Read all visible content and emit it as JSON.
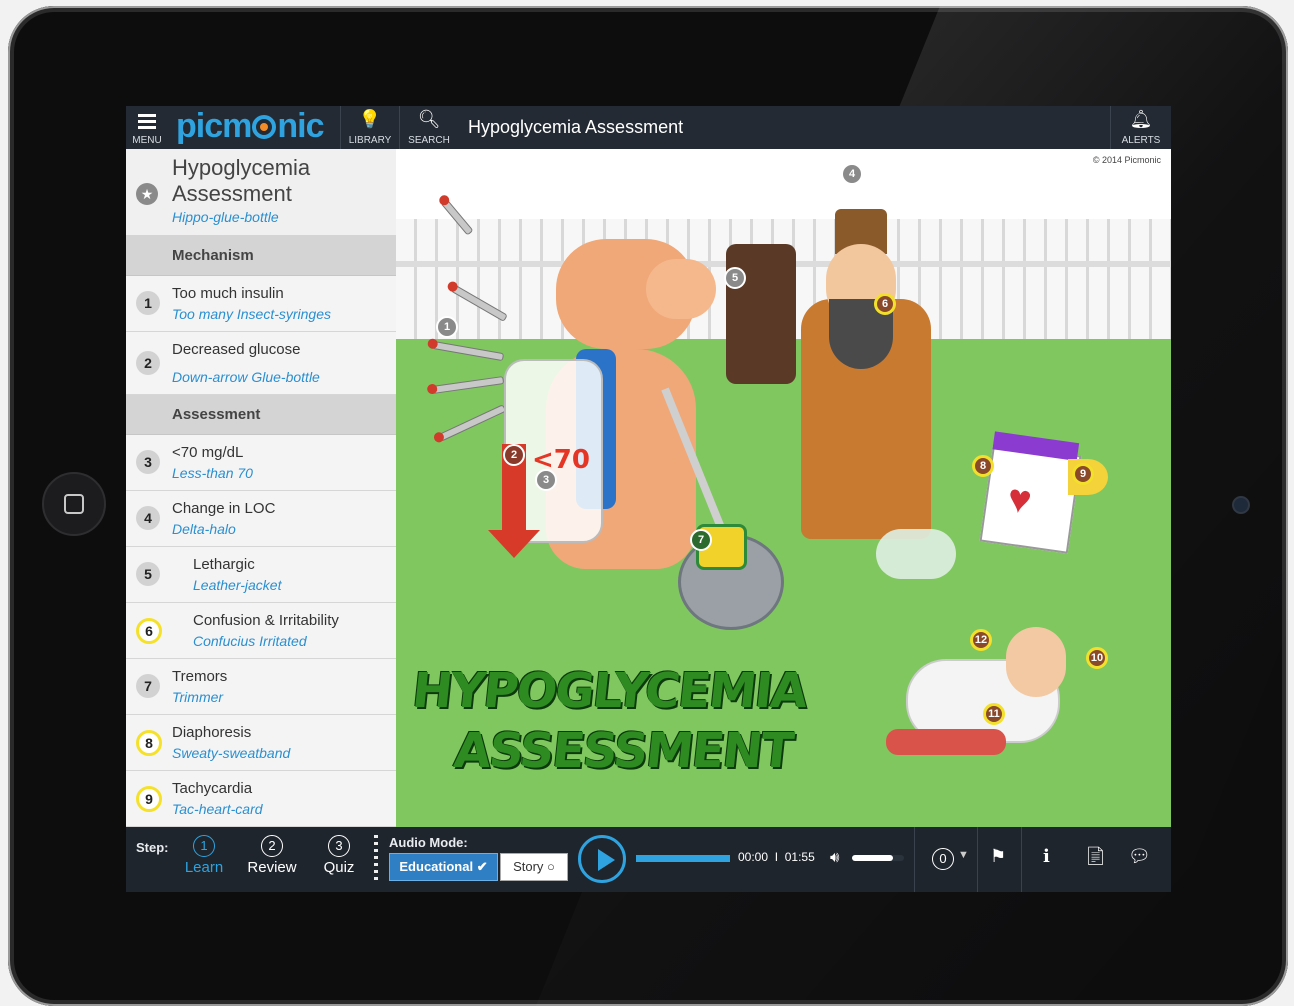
{
  "header": {
    "menu_label": "MENU",
    "logo": "picmonic",
    "library_label": "LIBRARY",
    "search_label": "SEARCH",
    "title": "Hypoglycemia  Assessment",
    "alerts_label": "ALERTS"
  },
  "sidebar": {
    "title": "Hypoglycemia Assessment",
    "subtitle": "Hippo-glue-bottle",
    "sections": [
      {
        "heading": "Mechanism",
        "items": [
          {
            "num": "1",
            "label": "Too much insulin",
            "mnemonic": "Too many Insect-syringes"
          },
          {
            "num": "2",
            "label": "Decreased glucose",
            "mnemonic": "Down-arrow Glue-bottle"
          }
        ]
      },
      {
        "heading": "Assessment",
        "items": [
          {
            "num": "3",
            "label": "<70 mg/dL",
            "mnemonic": "Less-than 70"
          },
          {
            "num": "4",
            "label": "Change in LOC",
            "mnemonic": "Delta-halo"
          },
          {
            "num": "5",
            "label": "Lethargic",
            "mnemonic": "Leather-jacket"
          },
          {
            "num": "6",
            "label": "Confusion & Irritability",
            "mnemonic": "Confucius Irritated"
          },
          {
            "num": "7",
            "label": "Tremors",
            "mnemonic": "Trimmer"
          },
          {
            "num": "8",
            "label": "Diaphoresis",
            "mnemonic": "Sweaty-sweatband"
          },
          {
            "num": "9",
            "label": "Tachycardia",
            "mnemonic": "Tac-heart-card"
          }
        ]
      }
    ],
    "collapse_icon": "chevron-left-icon"
  },
  "scene": {
    "copyright": "© 2014 Picmonic",
    "title_line1": "HYPOGLYCEMIA",
    "title_line2": "ASSESSMENT",
    "lt70_text": "<70",
    "markers": [
      "1",
      "2",
      "3",
      "4",
      "5",
      "6",
      "7",
      "8",
      "9",
      "10",
      "11",
      "12"
    ]
  },
  "bottom": {
    "step_label": "Step:",
    "steps": [
      {
        "num": "1",
        "label": "Learn"
      },
      {
        "num": "2",
        "label": "Review"
      },
      {
        "num": "3",
        "label": "Quiz"
      }
    ],
    "audio_mode_label": "Audio Mode:",
    "mode_educational": "Educational",
    "mode_story": "Story",
    "time_current": "00:00",
    "time_sep": "I",
    "time_total": "01:55",
    "volume_level": 0.78,
    "rating": "0",
    "icons": [
      "play-icon",
      "volume-icon",
      "flag-icon",
      "info-icon",
      "document-icon",
      "chat-icon"
    ]
  },
  "colors": {
    "brand_blue": "#2ea3df",
    "topbar_bg": "#232a33",
    "highlight_yellow": "#f5e12a"
  }
}
